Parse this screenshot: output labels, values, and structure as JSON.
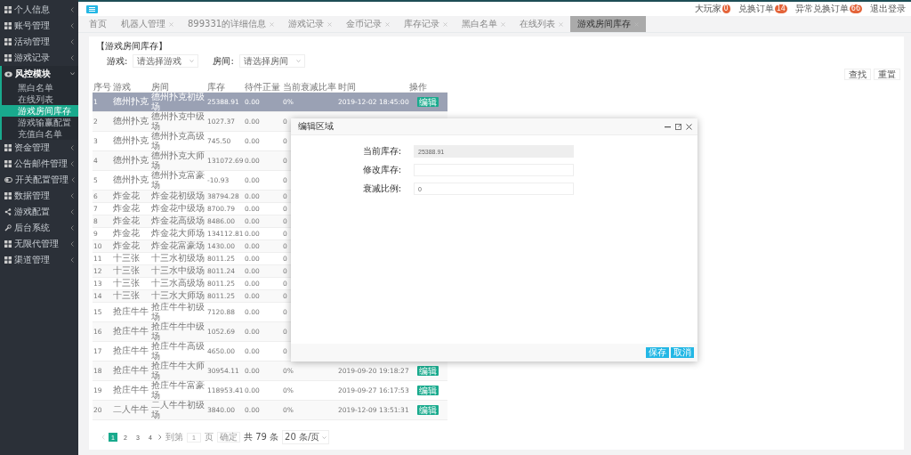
{
  "sidebar": {
    "items": [
      {
        "label": "个人信息",
        "expanded": false
      },
      {
        "label": "账号管理",
        "expanded": false
      },
      {
        "label": "活动管理",
        "expanded": false
      },
      {
        "label": "游戏记录",
        "expanded": false
      },
      {
        "label": "风控模块",
        "expanded": true,
        "children": [
          {
            "label": "黑白名单",
            "selected": false
          },
          {
            "label": "在线列表",
            "selected": false
          },
          {
            "label": "游戏房间库存",
            "selected": true
          },
          {
            "label": "游戏输赢配置",
            "selected": false
          },
          {
            "label": "充值白名单",
            "selected": false
          }
        ]
      },
      {
        "label": "资金管理",
        "expanded": false
      },
      {
        "label": "公告邮件管理",
        "expanded": false
      },
      {
        "label": "开关配置管理",
        "expanded": false
      },
      {
        "label": "数据管理",
        "expanded": false
      },
      {
        "label": "游戏配置",
        "expanded": false
      },
      {
        "label": "后台系统",
        "expanded": false
      },
      {
        "label": "无限代管理",
        "expanded": false
      },
      {
        "label": "渠道管理",
        "expanded": false
      }
    ]
  },
  "header": {
    "links": [
      {
        "label": "大玩家",
        "badge": "0"
      },
      {
        "label": "兑换订单",
        "badge": "14"
      },
      {
        "label": "异常兑换订单",
        "badge": "66"
      },
      {
        "label": "退出登录"
      }
    ]
  },
  "tabs": [
    {
      "label": "首页",
      "selected": false,
      "closable": false
    },
    {
      "label": "机器人管理",
      "selected": false,
      "closable": true
    },
    {
      "label": "899331的详细信息",
      "selected": false,
      "closable": true
    },
    {
      "label": "游戏记录",
      "selected": false,
      "closable": true
    },
    {
      "label": "金币记录",
      "selected": false,
      "closable": true
    },
    {
      "label": "库存记录",
      "selected": false,
      "closable": true
    },
    {
      "label": "黑白名单",
      "selected": false,
      "closable": true
    },
    {
      "label": "在线列表",
      "selected": false,
      "closable": true
    },
    {
      "label": "游戏房间库存",
      "selected": true,
      "closable": true
    }
  ],
  "panel": {
    "title": "【游戏房间库存】",
    "filters": [
      {
        "label": "游戏:",
        "placeholder": "请选择游戏"
      },
      {
        "label": "房间:",
        "placeholder": "请选择房间"
      }
    ],
    "buttons": [
      "查找",
      "重置"
    ]
  },
  "table": {
    "columns": [
      "序号",
      "游戏",
      "房间",
      "库存",
      "待件正量",
      "当前衰减比率",
      "时间",
      "操作"
    ],
    "rows": [
      {
        "no": "1",
        "game": "德州扑克",
        "room": "德州扑克初级场",
        "stock": "25388.91",
        "pending": "0.00",
        "rate": "0%",
        "time": "2019-12-02 18:45:00",
        "action": "编辑",
        "selected": true
      },
      {
        "no": "2",
        "game": "德州扑克",
        "room": "德州扑克中级场",
        "stock": "1027.37",
        "pending": "0.00",
        "rate": "0",
        "selected": false
      },
      {
        "no": "3",
        "game": "德州扑克",
        "room": "德州扑克高级场",
        "stock": "745.50",
        "pending": "0.00",
        "rate": "0",
        "selected": false
      },
      {
        "no": "4",
        "game": "德州扑克",
        "room": "德州扑克大师场",
        "stock": "131072.69",
        "pending": "0.00",
        "rate": "0",
        "selected": false
      },
      {
        "no": "5",
        "game": "德州扑克",
        "room": "德州扑克富豪场",
        "stock": "-10.93",
        "pending": "0.00",
        "rate": "0",
        "selected": false
      },
      {
        "no": "6",
        "game": "炸金花",
        "room": "炸金花初级场",
        "stock": "38794.28",
        "pending": "0.00",
        "rate": "0",
        "selected": false
      },
      {
        "no": "7",
        "game": "炸金花",
        "room": "炸金花中级场",
        "stock": "8700.79",
        "pending": "0.00",
        "rate": "0",
        "selected": false
      },
      {
        "no": "8",
        "game": "炸金花",
        "room": "炸金花高级场",
        "stock": "8486.00",
        "pending": "0.00",
        "rate": "0",
        "selected": false
      },
      {
        "no": "9",
        "game": "炸金花",
        "room": "炸金花大师场",
        "stock": "134112.81",
        "pending": "0.00",
        "rate": "0",
        "selected": false
      },
      {
        "no": "10",
        "game": "炸金花",
        "room": "炸金花富豪场",
        "stock": "1430.00",
        "pending": "0.00",
        "rate": "0",
        "selected": false
      },
      {
        "no": "11",
        "game": "十三张",
        "room": "十三水初级场",
        "stock": "8011.25",
        "pending": "0.00",
        "rate": "0",
        "selected": false
      },
      {
        "no": "12",
        "game": "十三张",
        "room": "十三水中级场",
        "stock": "8011.24",
        "pending": "0.00",
        "rate": "0",
        "selected": false
      },
      {
        "no": "13",
        "game": "十三张",
        "room": "十三水高级场",
        "stock": "8011.25",
        "pending": "0.00",
        "rate": "0",
        "selected": false
      },
      {
        "no": "14",
        "game": "十三张",
        "room": "十三水大师场",
        "stock": "8011.25",
        "pending": "0.00",
        "rate": "0",
        "selected": false
      },
      {
        "no": "15",
        "game": "抢庄牛牛",
        "room": "抢庄牛牛初级场",
        "stock": "7120.88",
        "pending": "0.00",
        "rate": "0",
        "selected": false
      },
      {
        "no": "16",
        "game": "抢庄牛牛",
        "room": "抢庄牛牛中级场",
        "stock": "1052.69",
        "pending": "0.00",
        "rate": "0",
        "selected": false
      },
      {
        "no": "17",
        "game": "抢庄牛牛",
        "room": "抢庄牛牛高级场",
        "stock": "4650.00",
        "pending": "0.00",
        "rate": "0",
        "selected": false
      },
      {
        "no": "18",
        "game": "抢庄牛牛",
        "room": "抢庄牛牛大师场",
        "stock": "30954.11",
        "pending": "0.00",
        "rate": "0%",
        "time": "2019-09-20 19:18:27",
        "action": "编辑",
        "selected": false
      },
      {
        "no": "19",
        "game": "抢庄牛牛",
        "room": "抢庄牛牛富豪场",
        "stock": "118953.41",
        "pending": "0.00",
        "rate": "0%",
        "time": "2019-09-27 16:17:53",
        "action": "编辑",
        "selected": false
      },
      {
        "no": "20",
        "game": "二人牛牛",
        "room": "二人牛牛初级场",
        "stock": "3840.00",
        "pending": "0.00",
        "rate": "0%",
        "time": "2019-12-09 13:51:31",
        "action": "编辑",
        "selected": false
      }
    ]
  },
  "pagination": {
    "pages": [
      {
        "label": "1",
        "selected": true
      },
      {
        "label": "2",
        "selected": false
      },
      {
        "label": "3",
        "selected": false
      },
      {
        "label": "4",
        "selected": false
      }
    ],
    "goto_label": "到第",
    "page_input": "1",
    "page_unit": "页",
    "confirm": "确定",
    "total": "共 79 条",
    "page_size": "20 条/页"
  },
  "dialog": {
    "title": "编辑区域",
    "fields": [
      {
        "label": "当前库存:",
        "value": "25388.91",
        "disabled": true
      },
      {
        "label": "修改库存:",
        "disabled": false
      },
      {
        "label": "衰减比例:",
        "value": "0",
        "disabled": false
      }
    ],
    "buttons": [
      "保存",
      "取消"
    ]
  }
}
